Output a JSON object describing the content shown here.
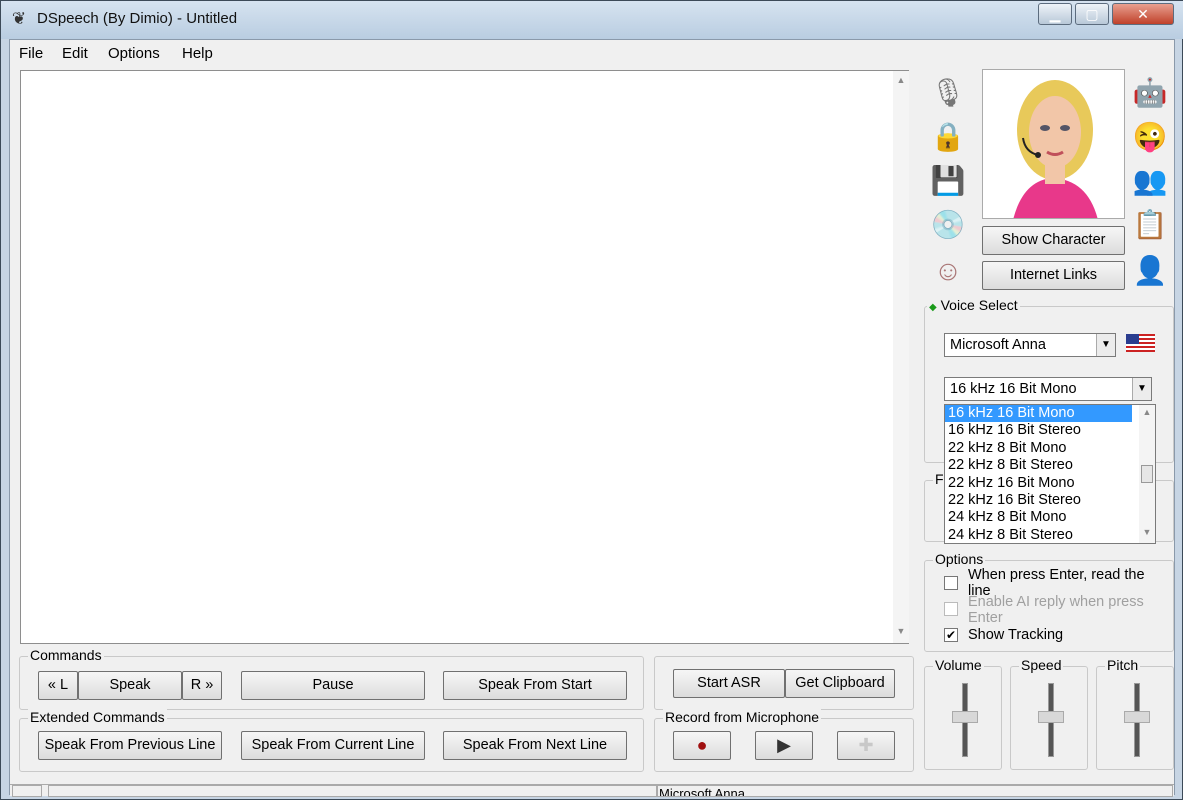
{
  "window": {
    "title": "DSpeech (By Dimio) - Untitled",
    "caption_minimize": "▁",
    "caption_maximize": "▢",
    "caption_close": "✕"
  },
  "menu": [
    "File",
    "Edit",
    "Options",
    "Help"
  ],
  "editor": {
    "text": ""
  },
  "character": {
    "show_label": "Show Character",
    "links_label": "Internet Links"
  },
  "voice_select": {
    "group_label": "Voice Select",
    "voice": "Microsoft Anna",
    "format": "16 kHz 16 Bit Mono",
    "format_options": [
      "16 kHz 16 Bit Mono",
      "16 kHz 16 Bit Stereo",
      "22 kHz 8 Bit Mono",
      "22 kHz 8 Bit Stereo",
      "22 kHz 16 Bit Mono",
      "22 kHz 16 Bit Stereo",
      "24 kHz 8 Bit Mono",
      "24 kHz 8 Bit Stereo"
    ],
    "hidden_group_initial": "F"
  },
  "options": {
    "group_label": "Options",
    "items": [
      {
        "label": "When press Enter, read the line",
        "checked": false
      },
      {
        "label": "Enable AI reply when press Enter",
        "checked": false,
        "disabled": true
      },
      {
        "label": "Show Tracking",
        "checked": true
      }
    ]
  },
  "sliders": [
    {
      "label": "Volume"
    },
    {
      "label": "Speed"
    },
    {
      "label": "Pitch"
    }
  ],
  "commands": {
    "group_label": "Commands",
    "left": "« L",
    "speak": "Speak",
    "right": "R »",
    "pause": "Pause",
    "speak_start": "Speak From Start"
  },
  "asr": {
    "start": "Start ASR",
    "clipboard": "Get Clipboard"
  },
  "extended": {
    "group_label": "Extended Commands",
    "prev": "Speak From Previous Line",
    "current": "Speak From Current Line",
    "next": "Speak From Next Line"
  },
  "record": {
    "group_label": "Record from Microphone",
    "record_glyph": "●",
    "play_glyph": "▶",
    "add_glyph": "✚"
  },
  "status": {
    "voice": "Microsoft Anna"
  }
}
